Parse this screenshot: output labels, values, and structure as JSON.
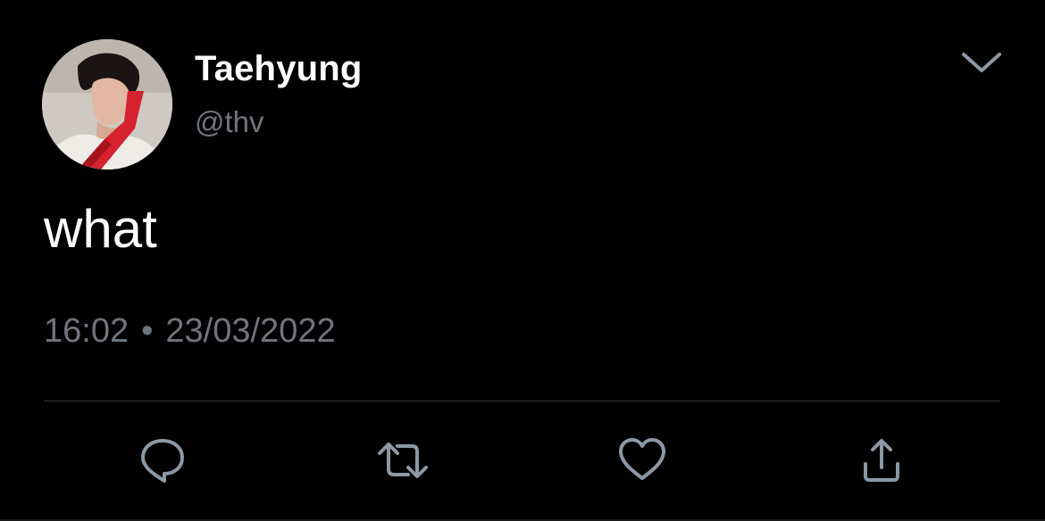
{
  "tweet": {
    "display_name": "Taehyung",
    "handle": "@thv",
    "text": "what",
    "time": "16:02",
    "separator": "•",
    "date": "23/03/2022"
  },
  "icons": {
    "more": "chevron-down-icon",
    "reply": "reply-bubble-icon",
    "retweet": "retweet-arrows-icon",
    "like": "heart-icon",
    "share": "share-upload-icon",
    "avatar": "profile-photo"
  },
  "colors": {
    "background": "#000000",
    "primary_text": "#ffffff",
    "secondary_text": "#6e767d",
    "divider": "#2f3336",
    "icon": "#8b98a5"
  }
}
